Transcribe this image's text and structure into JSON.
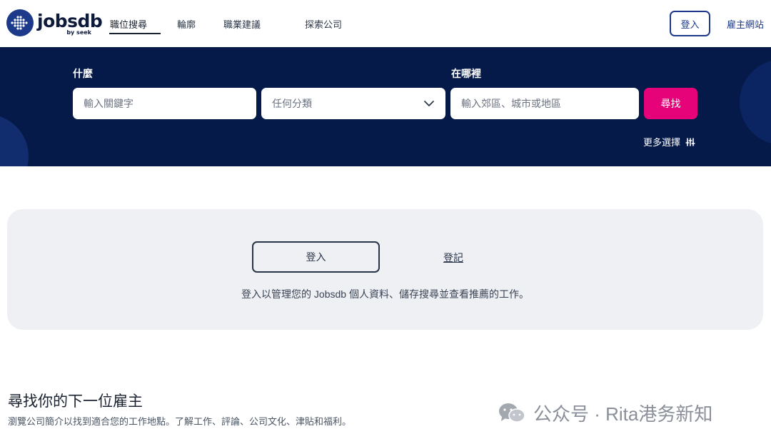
{
  "nav": {
    "logo_word": "jobsdb",
    "logo_sub": "by seek",
    "items": [
      {
        "label": "職位搜尋"
      },
      {
        "label": "輪廓"
      },
      {
        "label": "職業建議"
      },
      {
        "label": "探索公司"
      }
    ],
    "login_label": "登入",
    "employer_label": "雇主網站"
  },
  "search": {
    "what_label": "什麼",
    "where_label": "在哪裡",
    "keyword_placeholder": "輸入關鍵字",
    "category_value": "任何分類",
    "location_placeholder": "輸入郊區、城市或地區",
    "search_button": "尋找",
    "more_options": "更多選擇"
  },
  "signin_card": {
    "login_button": "登入",
    "register_link": "登記",
    "description": "登入以管理您的 Jobsdb 個人資料、儲存搜尋並查看推薦的工作。"
  },
  "employer_section": {
    "title": "尋找你的下一位雇主",
    "description": "瀏覽公司簡介以找到適合您的工作地點。了解工作、評論、公司文化、津貼和福利。"
  },
  "watermark": {
    "text": "公众号 · Rita港务新知"
  },
  "colors": {
    "banner": "#051a49",
    "accent_pink": "#e60278",
    "brand_blue": "#1d3a8a"
  }
}
